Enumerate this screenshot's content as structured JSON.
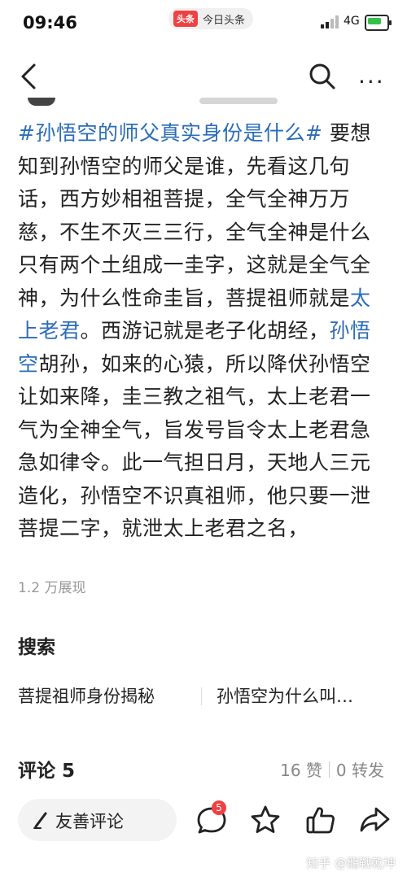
{
  "status_bar": {
    "time": "09:46",
    "app_badge": "头条",
    "app_name": "今日头条",
    "network": "4G"
  },
  "article": {
    "hashtag": "#孙悟空的师父真实身份是什么#",
    "p1": " 要想知到孙悟空的师父是谁，先看这几句话，西方妙相祖菩提，全气全神万万慈，不生不灭三三行，全气全神是什么只有两个土组成一圭字，这就是全气全神，为什么性命圭旨，菩提祖师就是",
    "link1": "太上老君",
    "p2": "。西游记就是老子化胡经，",
    "link2": "孙悟空",
    "p3": "胡孙，如来的心猿，所以降伏孙悟空让如来降，圭三教之祖气，太上老君一气为全神全气，旨发号旨令太上老君急急如律令。此一气担日月，天地人三元造化，孙悟空不识真祖师，他只要一泄菩提二字，就泄太上老君之名，",
    "views": "1.2 万展现"
  },
  "search": {
    "title": "搜索",
    "items": [
      "菩提祖师身份揭秘",
      "孙悟空为什么叫…"
    ]
  },
  "comments": {
    "header": "评论 5",
    "likes": "16 赞",
    "shares": "0 转发"
  },
  "bottom_bar": {
    "comment_placeholder": "友善评论",
    "comment_badge": "5"
  },
  "watermark": "知乎 @龍戰乾坤",
  "colors": {
    "link": "#2a6cb8",
    "badge": "#f04142",
    "battery": "#33c14c"
  }
}
